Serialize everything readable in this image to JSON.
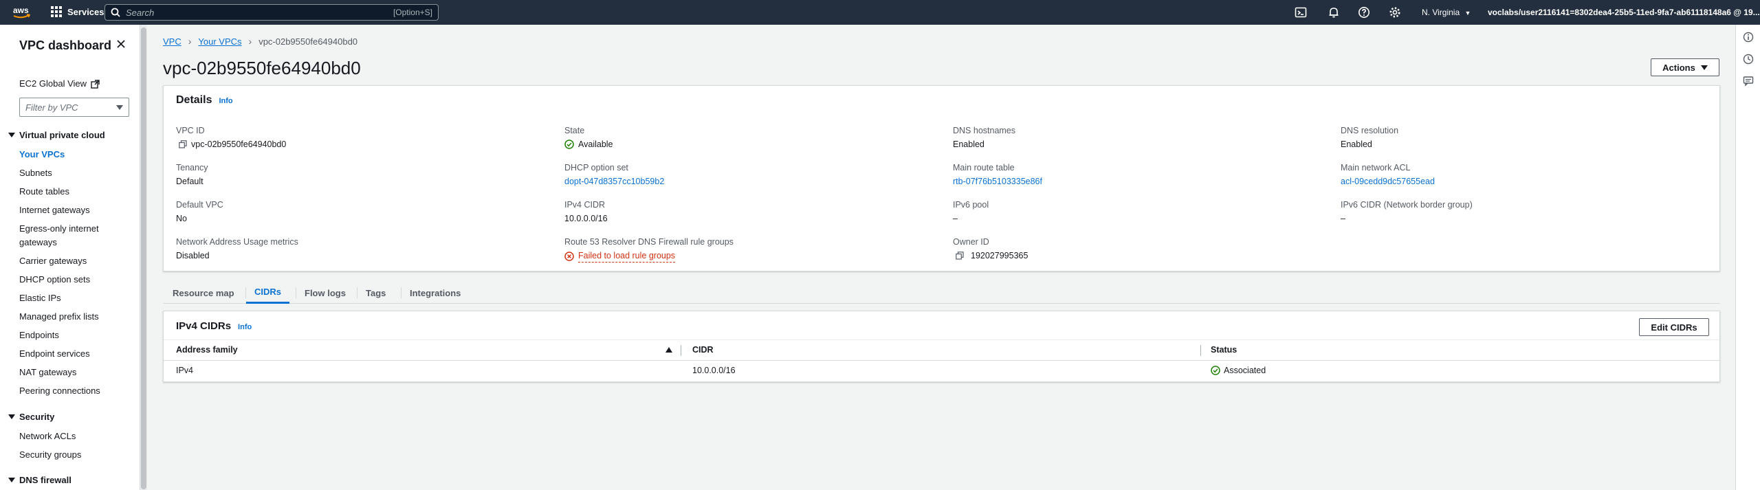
{
  "topnav": {
    "logo_text": "aws",
    "services_label": "Services",
    "search_placeholder": "Search",
    "search_shortcut": "[Option+S]",
    "region": "N. Virginia",
    "account": "voclabs/user2116141=8302dea4-25b5-11ed-9fa7-ab61118148a6 @ 19...",
    "icons": [
      "cloudshell-icon",
      "bell-icon",
      "help-icon",
      "gear-icon"
    ]
  },
  "sidebar": {
    "title": "VPC dashboard",
    "ec2_global_view": "EC2 Global View",
    "filter_placeholder": "Filter by VPC",
    "sections": [
      {
        "title": "Virtual private cloud",
        "items": [
          "Your VPCs",
          "Subnets",
          "Route tables",
          "Internet gateways",
          "Egress-only internet",
          "gateways",
          "Carrier gateways",
          "DHCP option sets",
          "Elastic IPs",
          "Managed prefix lists",
          "Endpoints",
          "Endpoint services",
          "NAT gateways",
          "Peering connections"
        ]
      },
      {
        "title": "Security",
        "items": [
          "Network ACLs",
          "Security groups"
        ]
      },
      {
        "title": "DNS firewall",
        "items": []
      }
    ],
    "active_item": "Your VPCs"
  },
  "breadcrumb": {
    "root": "VPC",
    "parent": "Your VPCs",
    "current": "vpc-02b9550fe64940bd0"
  },
  "page": {
    "title": "vpc-02b9550fe64940bd0",
    "actions_label": "Actions"
  },
  "details": {
    "heading": "Details",
    "info": "Info",
    "fields": {
      "vpc_id": {
        "label": "VPC ID",
        "value": "vpc-02b9550fe64940bd0"
      },
      "state": {
        "label": "State",
        "value": "Available"
      },
      "dns_hostnames": {
        "label": "DNS hostnames",
        "value": "Enabled"
      },
      "dns_resolution": {
        "label": "DNS resolution",
        "value": "Enabled"
      },
      "tenancy": {
        "label": "Tenancy",
        "value": "Default"
      },
      "dhcp": {
        "label": "DHCP option set",
        "value": "dopt-047d8357cc10b59b2"
      },
      "main_rt": {
        "label": "Main route table",
        "value": "rtb-07f76b5103335e86f"
      },
      "main_acl": {
        "label": "Main network ACL",
        "value": "acl-09cedd9dc57655ead"
      },
      "default_vpc": {
        "label": "Default VPC",
        "value": "No"
      },
      "ipv4_cidr": {
        "label": "IPv4 CIDR",
        "value": "10.0.0.0/16"
      },
      "ipv6_pool": {
        "label": "IPv6 pool",
        "value": "–"
      },
      "ipv6_cidr": {
        "label": "IPv6 CIDR (Network border group)",
        "value": "–"
      },
      "nau": {
        "label": "Network Address Usage metrics",
        "value": "Disabled"
      },
      "r53": {
        "label": "Route 53 Resolver DNS Firewall rule groups",
        "value": "Failed to load rule groups"
      },
      "owner": {
        "label": "Owner ID",
        "value": "192027995365"
      }
    }
  },
  "tabs": [
    "Resource map",
    "CIDRs",
    "Flow logs",
    "Tags",
    "Integrations"
  ],
  "active_tab": "CIDRs",
  "cidrs": {
    "heading": "IPv4 CIDRs",
    "info": "Info",
    "edit_label": "Edit CIDRs",
    "columns": [
      "Address family",
      "CIDR",
      "Status"
    ],
    "rows": [
      {
        "family": "IPv4",
        "cidr": "10.0.0.0/16",
        "status": "Associated"
      }
    ]
  },
  "colors": {
    "nav_bg": "#232f3e",
    "link": "#0972d3",
    "success": "#1d8102",
    "error": "#d13212"
  }
}
